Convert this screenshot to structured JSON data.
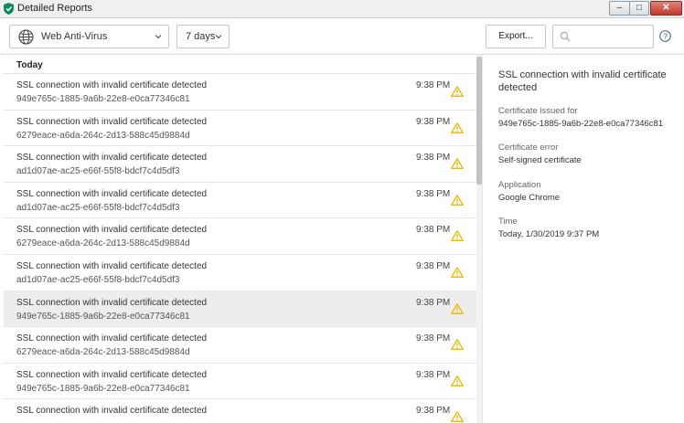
{
  "window": {
    "title": "Detailed Reports",
    "minimize_glyph": "–",
    "maximize_glyph": "□",
    "close_glyph": "✕"
  },
  "toolbar": {
    "component_selected": "Web Anti-Virus",
    "period_selected": "7 days",
    "export_label": "Export...",
    "search_value": "",
    "search_placeholder": ""
  },
  "colors": {
    "accent_green": "#0f8a5f",
    "warning_yellow": "#f2b705"
  },
  "list": {
    "group_header": "Today",
    "rows": [
      {
        "message": "SSL connection with invalid certificate detected",
        "id": "949e765c-1885-9a6b-22e8-e0ca77346c81",
        "time": "9:38 PM",
        "icon": "warning-icon"
      },
      {
        "message": "SSL connection with invalid certificate detected",
        "id": "6279eace-a6da-264c-2d13-588c45d9884d",
        "time": "9:38 PM",
        "icon": "warning-icon"
      },
      {
        "message": "SSL connection with invalid certificate detected",
        "id": "ad1d07ae-ac25-e66f-55f8-bdcf7c4d5df3",
        "time": "9:38 PM",
        "icon": "warning-icon"
      },
      {
        "message": "SSL connection with invalid certificate detected",
        "id": "ad1d07ae-ac25-e66f-55f8-bdcf7c4d5df3",
        "time": "9:38 PM",
        "icon": "warning-icon"
      },
      {
        "message": "SSL connection with invalid certificate detected",
        "id": "6279eace-a6da-264c-2d13-588c45d9884d",
        "time": "9:38 PM",
        "icon": "warning-icon"
      },
      {
        "message": "SSL connection with invalid certificate detected",
        "id": "ad1d07ae-ac25-e66f-55f8-bdcf7c4d5df3",
        "time": "9:38 PM",
        "icon": "warning-icon"
      },
      {
        "message": "SSL connection with invalid certificate detected",
        "id": "949e765c-1885-9a6b-22e8-e0ca77346c81",
        "time": "9:38 PM",
        "icon": "warning-icon"
      },
      {
        "message": "SSL connection with invalid certificate detected",
        "id": "6279eace-a6da-264c-2d13-588c45d9884d",
        "time": "9:38 PM",
        "icon": "warning-icon"
      },
      {
        "message": "SSL connection with invalid certificate detected",
        "id": "949e765c-1885-9a6b-22e8-e0ca77346c81",
        "time": "9:38 PM",
        "icon": "warning-icon"
      },
      {
        "message": "SSL connection with invalid certificate detected",
        "id": "",
        "time": "9:38 PM",
        "icon": "warning-icon"
      }
    ]
  },
  "details": {
    "title": "SSL connection with invalid certificate detected",
    "fields": [
      {
        "label": "Certificate issued for",
        "value": "949e765c-1885-9a6b-22e8-e0ca77346c81"
      },
      {
        "label": "Certificate error",
        "value": "Self-signed certificate"
      },
      {
        "label": "Application",
        "value": "Google Chrome"
      },
      {
        "label": "Time",
        "value": "Today, 1/30/2019 9:37 PM"
      }
    ]
  }
}
